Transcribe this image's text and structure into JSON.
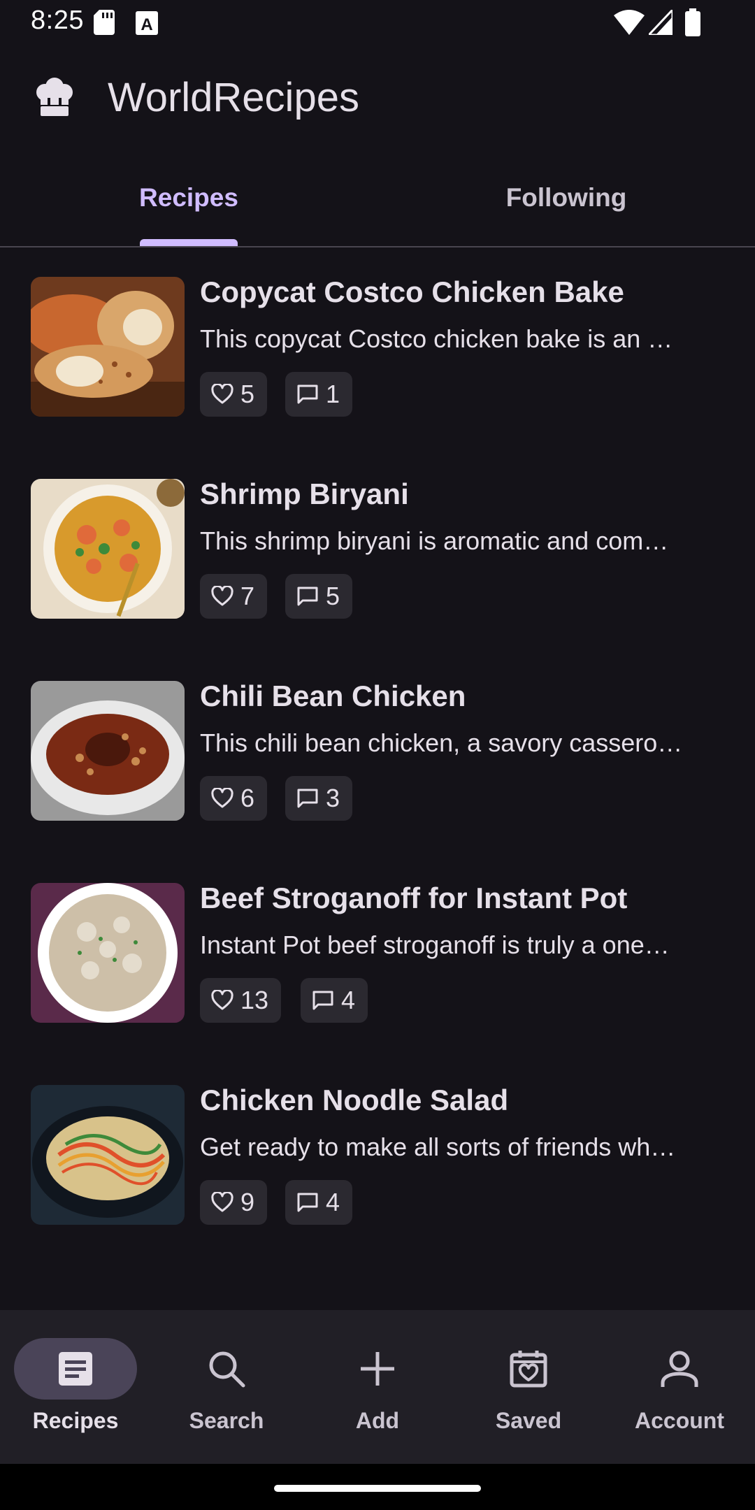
{
  "status_bar": {
    "time": "8:25",
    "icons": [
      "sd-card-icon",
      "keyboard-a-icon",
      "wifi-icon",
      "signal-icon",
      "battery-icon"
    ]
  },
  "app_bar": {
    "title": "WorldRecipes",
    "logo_icon": "chef-hat-icon"
  },
  "tabs": [
    {
      "label": "Recipes",
      "selected": true
    },
    {
      "label": "Following",
      "selected": false
    }
  ],
  "recipes": [
    {
      "title": "Copycat Costco Chicken Bake",
      "description": "This copycat Costco chicken bake is an …",
      "likes": "5",
      "comments": "1"
    },
    {
      "title": "Shrimp Biryani",
      "description": "This shrimp biryani is aromatic and com…",
      "likes": "7",
      "comments": "5"
    },
    {
      "title": "Chili Bean Chicken",
      "description": "This chili bean chicken, a savory cassero…",
      "likes": "6",
      "comments": "3"
    },
    {
      "title": "Beef Stroganoff for Instant Pot",
      "description": "Instant Pot beef stroganoff is truly a one…",
      "likes": "13",
      "comments": "4"
    },
    {
      "title": "Chicken Noodle Salad",
      "description": "Get ready to make all sorts of friends wh…",
      "likes": "9",
      "comments": "4"
    }
  ],
  "bottom_nav": [
    {
      "label": "Recipes",
      "icon": "article-icon",
      "active": true
    },
    {
      "label": "Search",
      "icon": "search-icon",
      "active": false
    },
    {
      "label": "Add",
      "icon": "plus-icon",
      "active": false
    },
    {
      "label": "Saved",
      "icon": "calendar-heart-icon",
      "active": false
    },
    {
      "label": "Account",
      "icon": "person-icon",
      "active": false
    }
  ],
  "colors": {
    "background": "#141218",
    "accent": "#D0BCFF",
    "chip": "#2B2930",
    "nav_background": "#211F26",
    "nav_active_pill": "#4A4458"
  }
}
